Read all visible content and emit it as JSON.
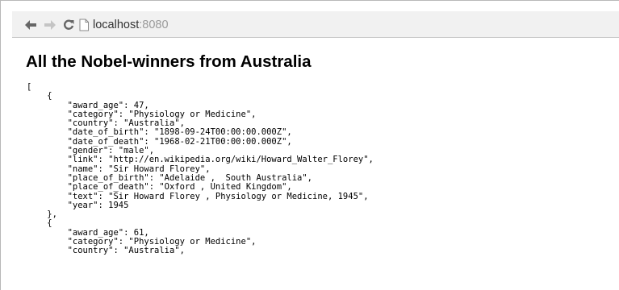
{
  "browser": {
    "url_host": "localhost",
    "url_port": ":8080",
    "icons": {
      "back": "arrow-left-icon",
      "forward": "arrow-right-icon",
      "reload": "reload-icon",
      "page": "page-icon"
    }
  },
  "page": {
    "title": "All the Nobel-winners from Australia",
    "lines": [
      "[",
      "    {",
      "        \"award_age\": 47,",
      "        \"category\": \"Physiology or Medicine\",",
      "        \"country\": \"Australia\",",
      "        \"date_of_birth\": \"1898-09-24T00:00:00.000Z\",",
      "        \"date_of_death\": \"1968-02-21T00:00:00.000Z\",",
      "        \"gender\": \"male\",",
      "        \"link\": \"http://en.wikipedia.org/wiki/Howard_Walter_Florey\",",
      "        \"name\": \"Sir Howard Florey\",",
      "        \"place_of_birth\": \"Adelaide ,  South Australia\",",
      "        \"place_of_death\": \"Oxford , United Kingdom\",",
      "        \"text\": \"Sir Howard Florey , Physiology or Medicine, 1945\",",
      "        \"year\": 1945",
      "    },",
      "    {",
      "        \"award_age\": 61,",
      "        \"category\": \"Physiology or Medicine\",",
      "        \"country\": \"Australia\","
    ]
  }
}
